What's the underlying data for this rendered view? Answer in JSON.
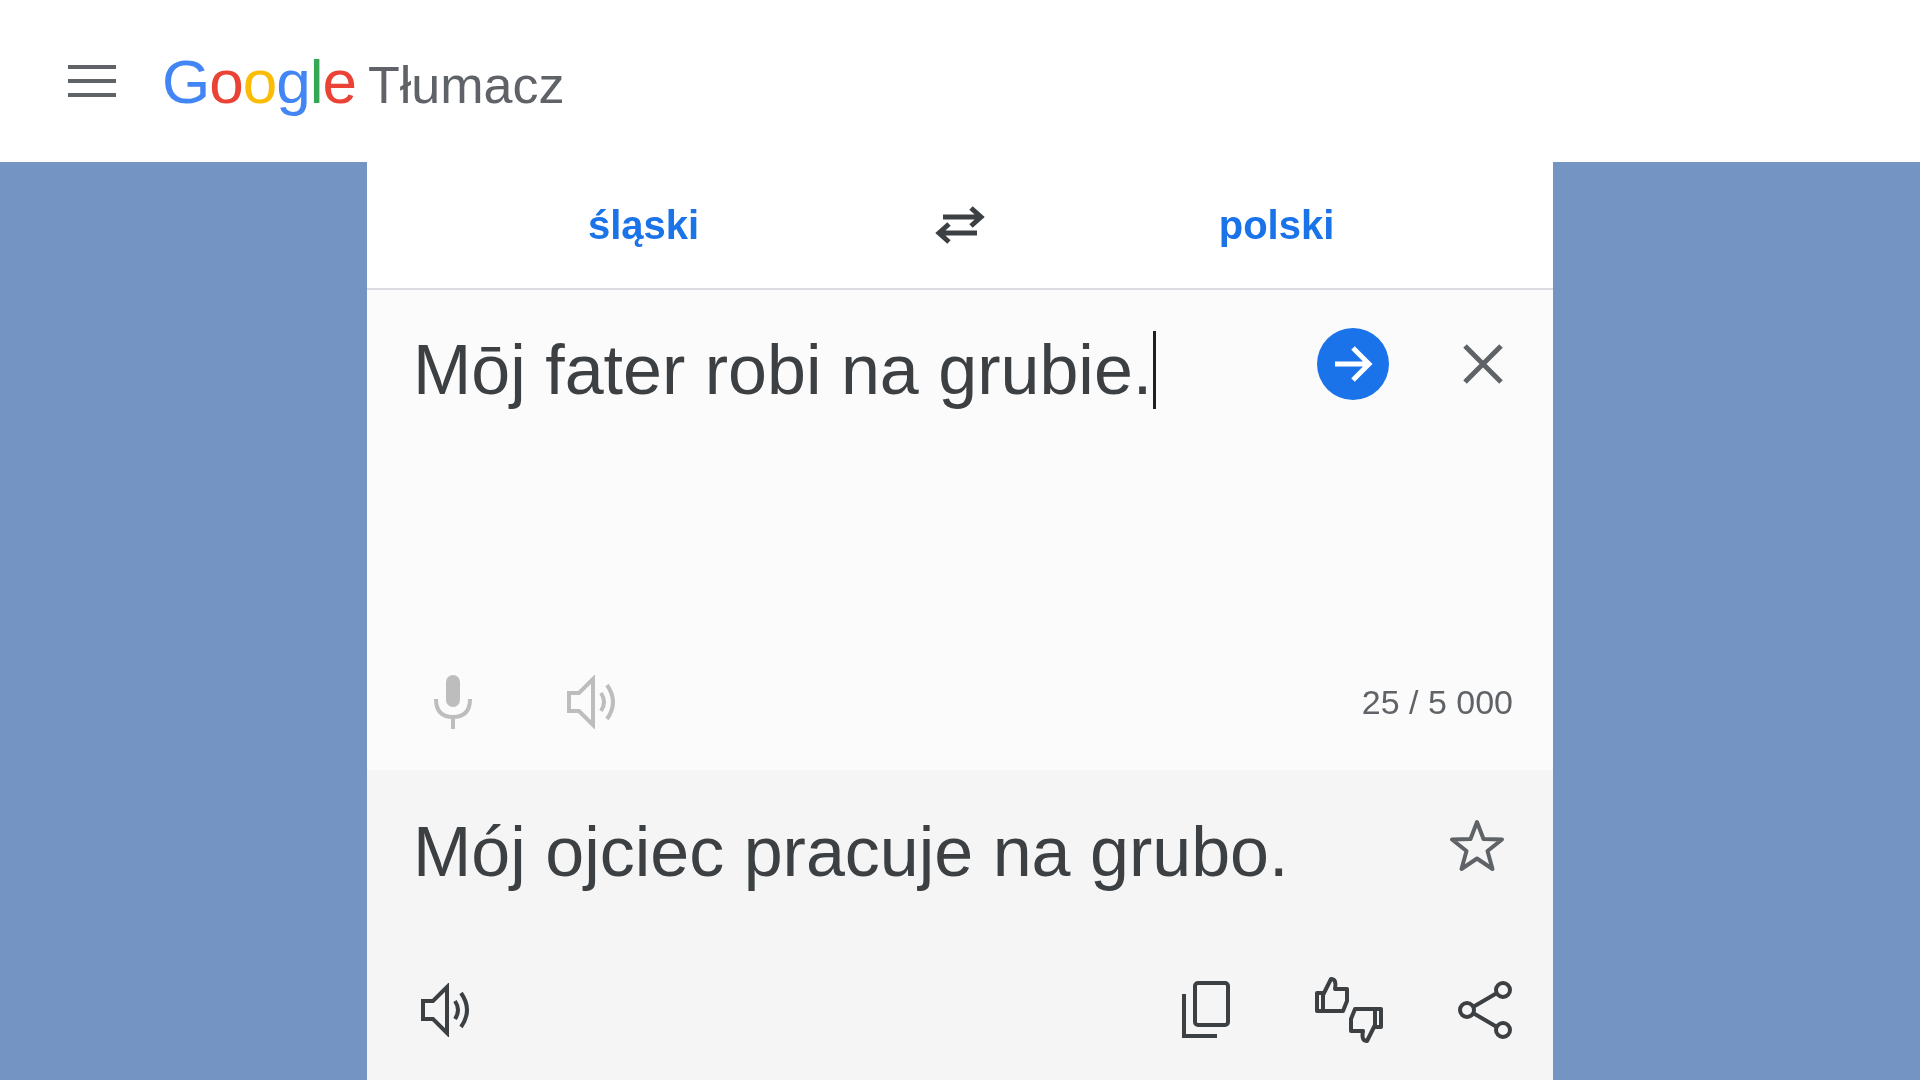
{
  "header": {
    "logo": "Google",
    "product": "Tłumacz"
  },
  "languages": {
    "source": "śląski",
    "target": "polski"
  },
  "input": {
    "value": "Mōj fater robi na grubie.",
    "counter": "25 / 5 000"
  },
  "output": {
    "text": "Mój ojciec pracuje na grubo.",
    "starred": false
  }
}
